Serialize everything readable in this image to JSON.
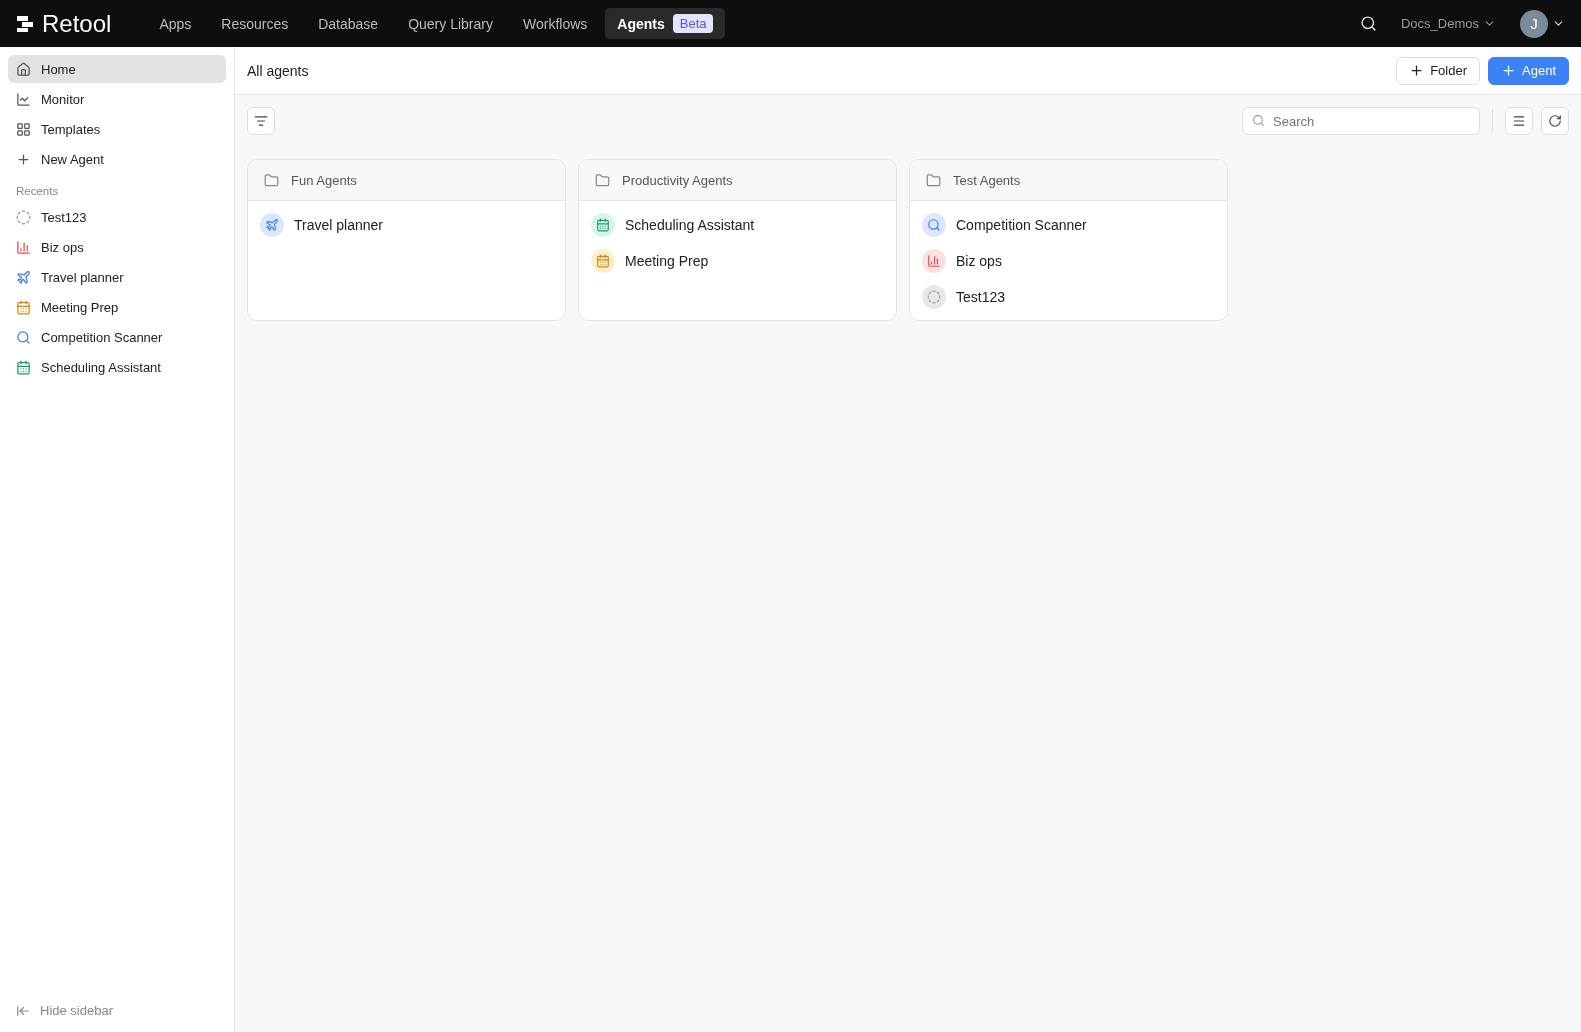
{
  "topbar": {
    "logo": "Retool",
    "tabs": [
      {
        "label": "Apps",
        "selected": false
      },
      {
        "label": "Resources",
        "selected": false
      },
      {
        "label": "Database",
        "selected": false
      },
      {
        "label": "Query Library",
        "selected": false
      },
      {
        "label": "Workflows",
        "selected": false
      },
      {
        "label": "Agents",
        "selected": true,
        "badge": "Beta"
      }
    ],
    "workspace": "Docs_Demos",
    "avatar": "J"
  },
  "sidebar": {
    "items": [
      {
        "label": "Home",
        "kind": "home",
        "selected": true
      },
      {
        "label": "Monitor",
        "kind": "monitor",
        "selected": false
      },
      {
        "label": "Templates",
        "kind": "templates",
        "selected": false
      },
      {
        "label": "New Agent",
        "kind": "plus",
        "selected": false
      }
    ],
    "recents_title": "Recents",
    "recents": [
      {
        "label": "Test123",
        "kind": "dashed"
      },
      {
        "label": "Biz ops",
        "kind": "bars"
      },
      {
        "label": "Travel planner",
        "kind": "plane"
      },
      {
        "label": "Meeting Prep",
        "kind": "calendar-orange"
      },
      {
        "label": "Competition Scanner",
        "kind": "search"
      },
      {
        "label": "Scheduling Assistant",
        "kind": "calendar-green"
      }
    ],
    "hide": "Hide sidebar"
  },
  "header": {
    "title": "All agents",
    "buttons": [
      {
        "label": "Folder",
        "kind": "secondary"
      },
      {
        "label": "Agent",
        "kind": "primary"
      }
    ]
  },
  "search": {
    "placeholder": "Search"
  },
  "folders": [
    {
      "name": "Fun Agents",
      "agents": [
        {
          "label": "Travel planner",
          "kind": "plane"
        }
      ]
    },
    {
      "name": "Productivity Agents",
      "agents": [
        {
          "label": "Scheduling Assistant",
          "kind": "calendar-green"
        },
        {
          "label": "Meeting Prep",
          "kind": "calendar-orange"
        }
      ]
    },
    {
      "name": "Test Agents",
      "agents": [
        {
          "label": "Competition Scanner",
          "kind": "search"
        },
        {
          "label": "Biz ops",
          "kind": "bars"
        },
        {
          "label": "Test123",
          "kind": "dashed"
        }
      ]
    }
  ]
}
